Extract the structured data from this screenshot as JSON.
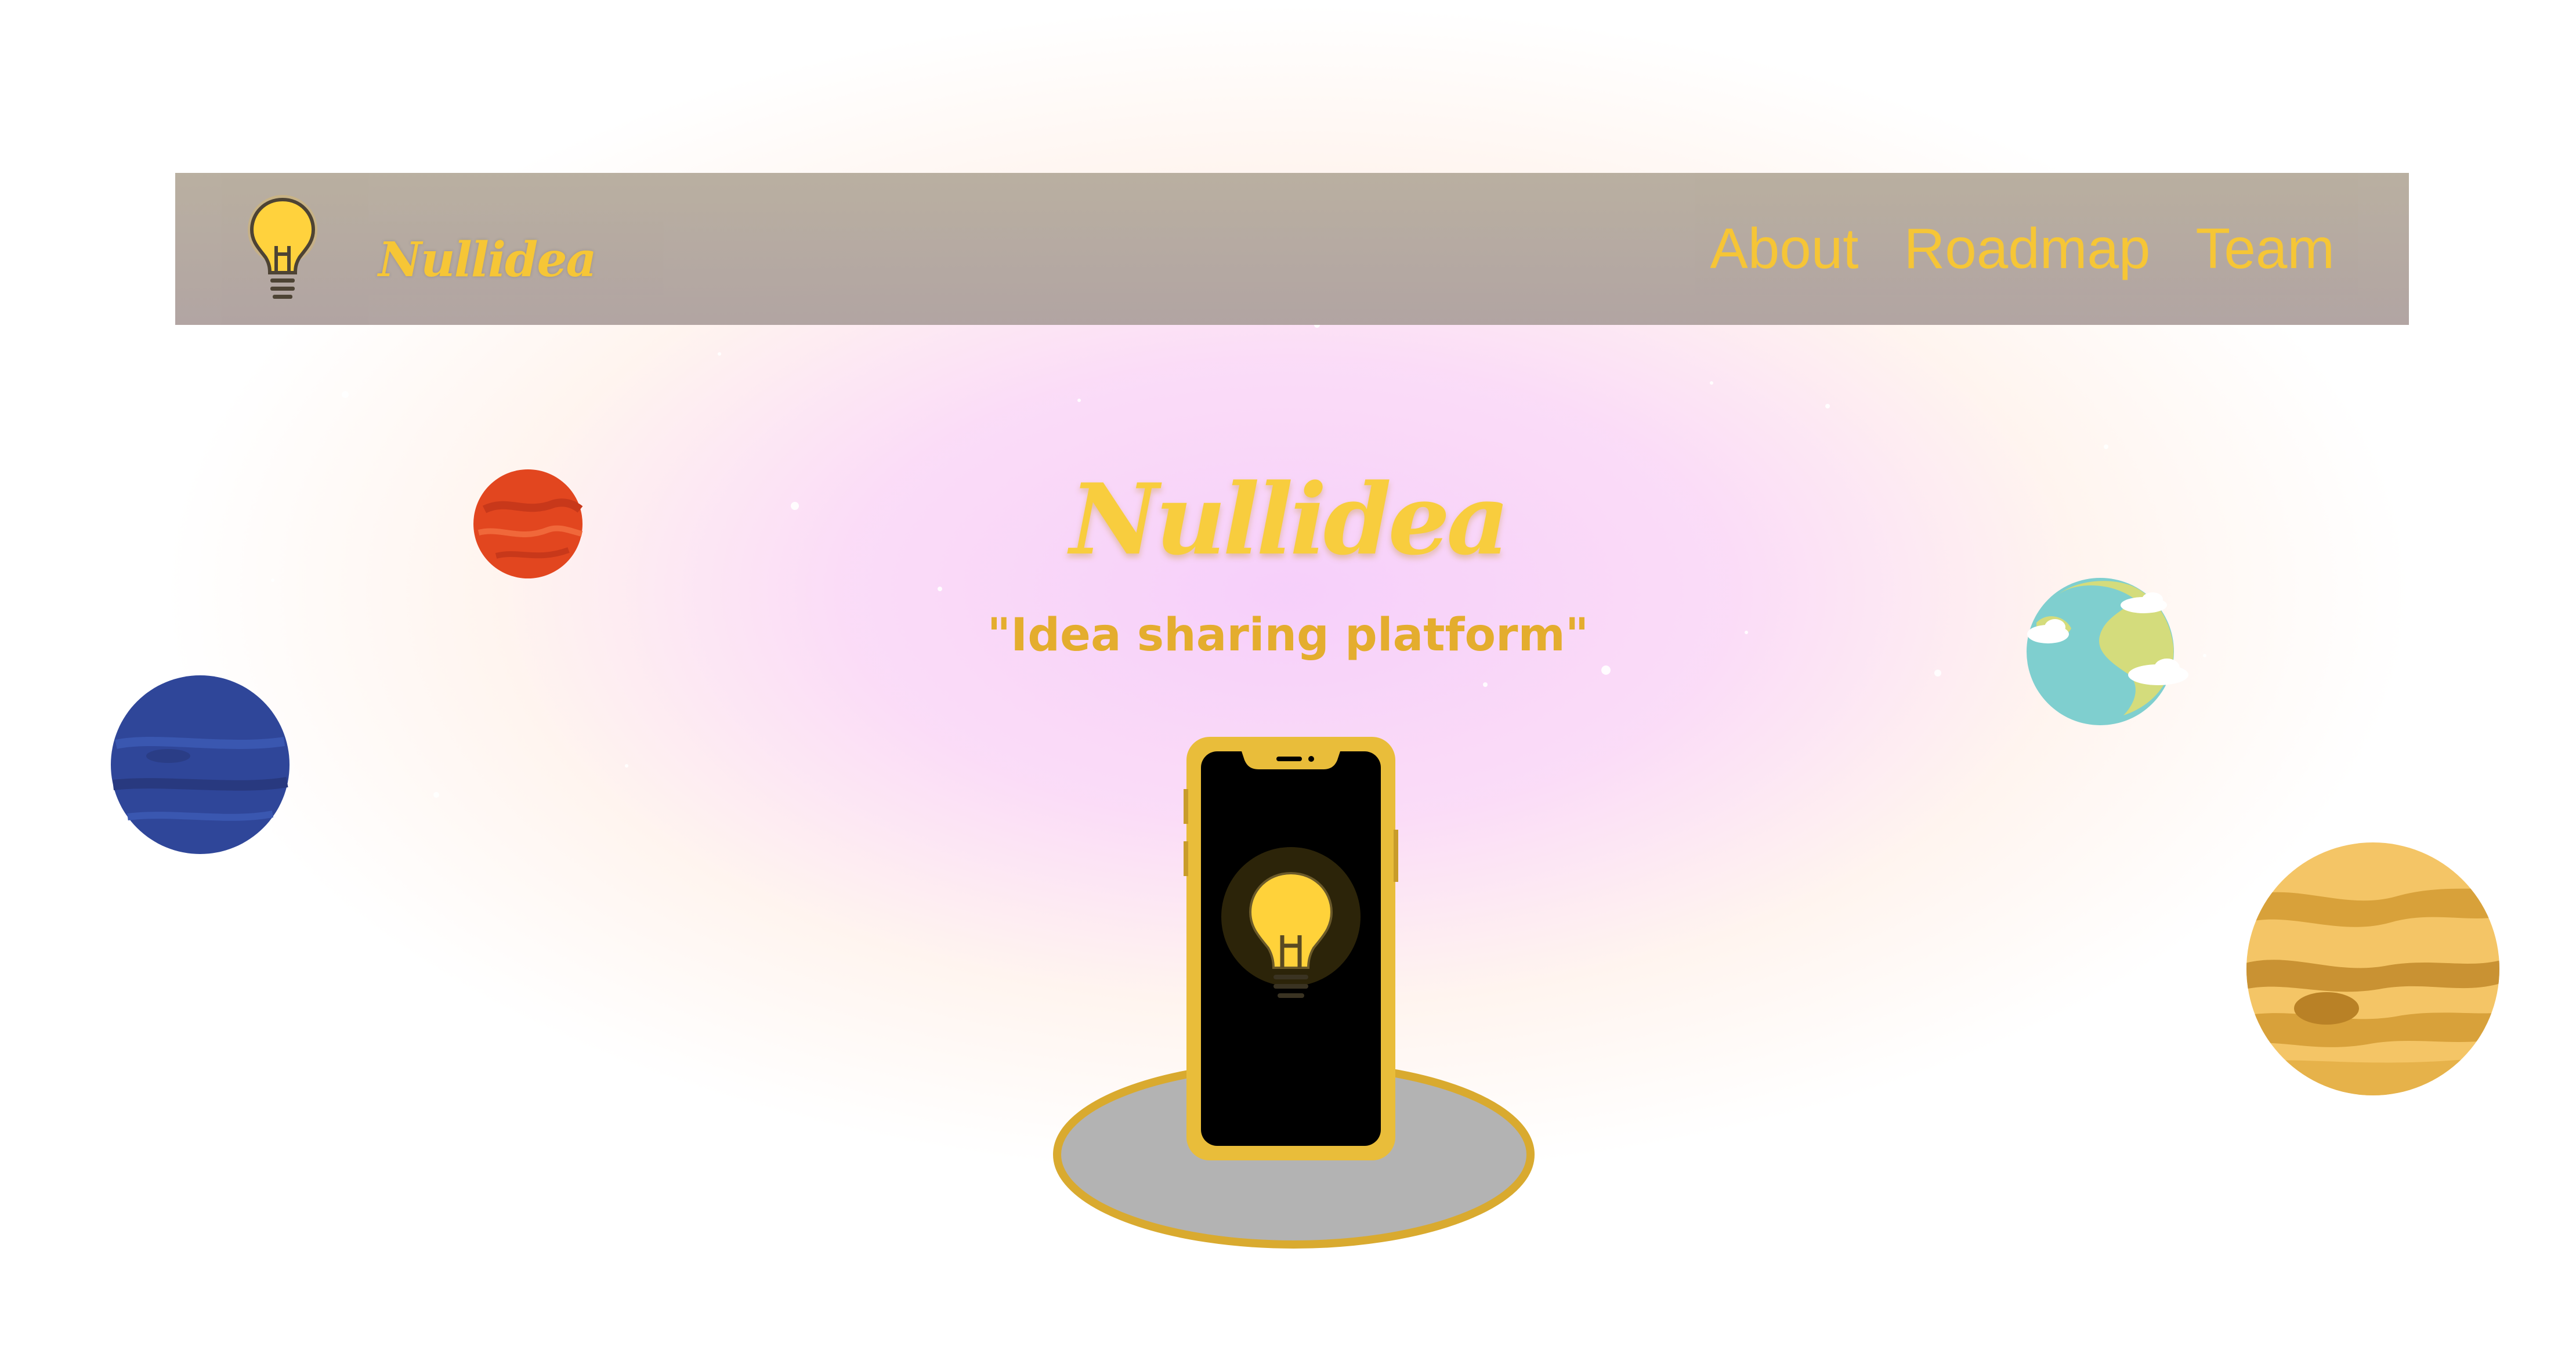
{
  "header": {
    "brand": "Nullidea",
    "logo_icon": "lightbulb-icon",
    "nav": [
      {
        "label": "About"
      },
      {
        "label": "Roadmap"
      },
      {
        "label": "Team"
      }
    ]
  },
  "hero": {
    "title": "Nullidea",
    "subtitle": "\"Idea sharing platform\"",
    "illustration_icons": [
      "smartphone-icon",
      "lightbulb-icon"
    ]
  },
  "decor": {
    "planets": [
      "mars-planet",
      "neptune-planet",
      "earth-planet",
      "jupiter-planet"
    ]
  },
  "colors": {
    "accent": "#f6c533",
    "navbar": "#b5a9a0",
    "phone_frame": "#e9bd3a",
    "phone_screen": "#000000",
    "pedestal": "#b3b3b3"
  }
}
